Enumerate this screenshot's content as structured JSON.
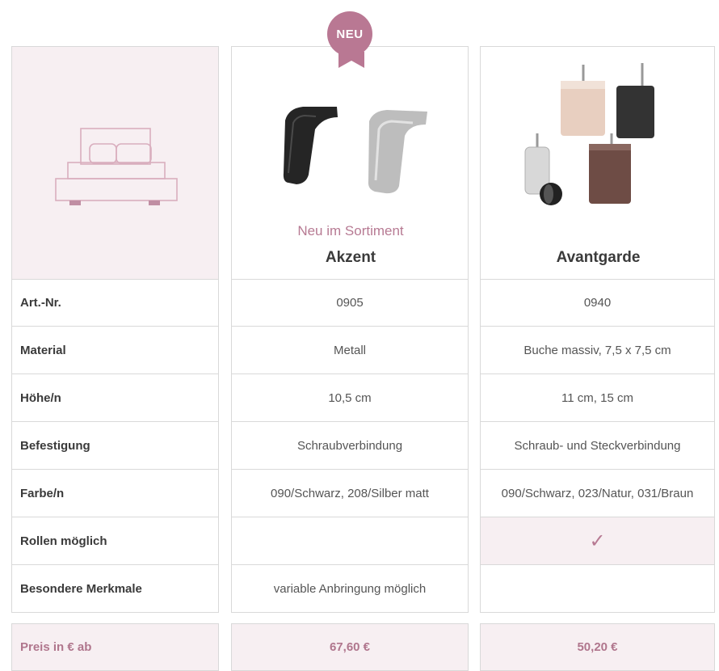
{
  "badge": "NEU",
  "products": [
    {
      "subtitle": "Neu im Sortiment",
      "name": "Akzent"
    },
    {
      "subtitle": "",
      "name": "Avantgarde"
    }
  ],
  "rows": [
    {
      "label": "Art.-Nr.",
      "values": [
        "0905",
        "0940"
      ]
    },
    {
      "label": "Material",
      "values": [
        "Metall",
        "Buche massiv, 7,5 x 7,5 cm"
      ]
    },
    {
      "label": "Höhe/n",
      "values": [
        "10,5 cm",
        "11 cm, 15 cm"
      ]
    },
    {
      "label": "Befestigung",
      "values": [
        "Schraubverbindung",
        "Schraub- und Steckverbindung"
      ]
    },
    {
      "label": "Farbe/n",
      "values": [
        "090/Schwarz, 208/Silber matt",
        "090/Schwarz, 023/Natur, 031/Braun"
      ]
    },
    {
      "label": "Rollen möglich",
      "values": [
        "",
        "✓"
      ]
    },
    {
      "label": "Besondere Merkmale",
      "values": [
        "variable Anbringung möglich",
        ""
      ]
    }
  ],
  "price": {
    "label": "Preis in € ab",
    "values": [
      "67,60 €",
      "50,20 €"
    ]
  },
  "colors": {
    "accent": "#b97893",
    "shade": "#f7eff2",
    "border": "#d9d9d9"
  },
  "icons": {
    "label_column": "bed-icon"
  }
}
